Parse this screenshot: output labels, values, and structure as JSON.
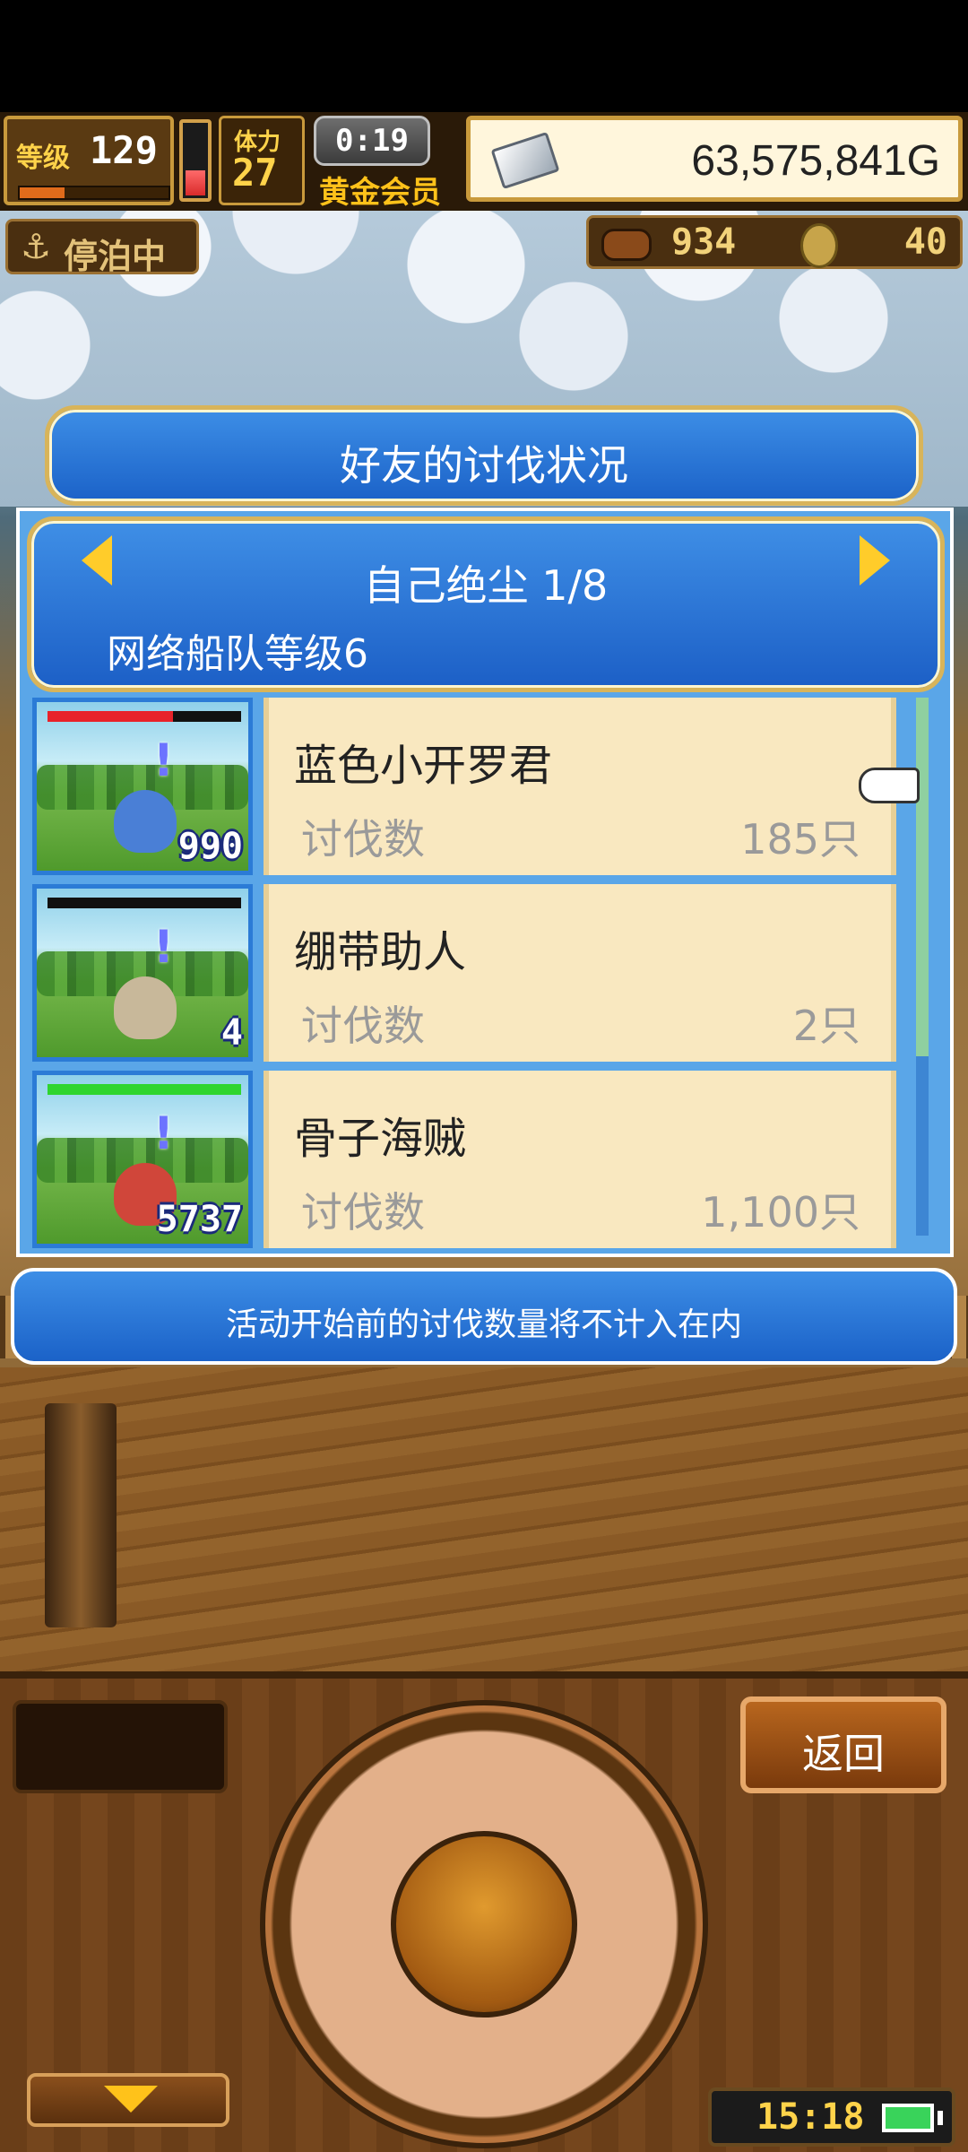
{
  "hud": {
    "level_label": "等级",
    "level_value": "129",
    "level_progress": 0.3,
    "stamina_label": "体力",
    "stamina_value": "27",
    "stamina_fill": 0.35,
    "timer": "0:19",
    "vip_label": "黄金会员",
    "gold": "63,575,841G",
    "dock_label": "停泊中",
    "food_value": "934",
    "coin_value": "40"
  },
  "dialog": {
    "title": "好友的讨伐状况",
    "friend_name": "自己绝尘 1/8",
    "fleet_level": "网络船队等级6",
    "notice": "活动开始前的讨伐数量将不计入在内"
  },
  "monsters": [
    {
      "name": "蓝色小开罗君",
      "kill_label": "讨伐数",
      "kill_value": "185只",
      "badge": "990",
      "hp_fill": 0.65,
      "hp_color": "#e8222a",
      "body_color": "#4a7fd6"
    },
    {
      "name": "绷带助人",
      "kill_label": "讨伐数",
      "kill_value": "2只",
      "badge": "4",
      "hp_fill": 0.0,
      "hp_color": "#e8222a",
      "body_color": "#c8b89a"
    },
    {
      "name": "骨子海贼",
      "kill_label": "讨伐数",
      "kill_value": "1,100只",
      "badge": "5737",
      "hp_fill": 1.0,
      "hp_color": "#2fd52f",
      "body_color": "#d0463a"
    }
  ],
  "controls": {
    "back_label": "返回",
    "clock": "15:18"
  },
  "icons": {
    "anchor": "⚓"
  }
}
